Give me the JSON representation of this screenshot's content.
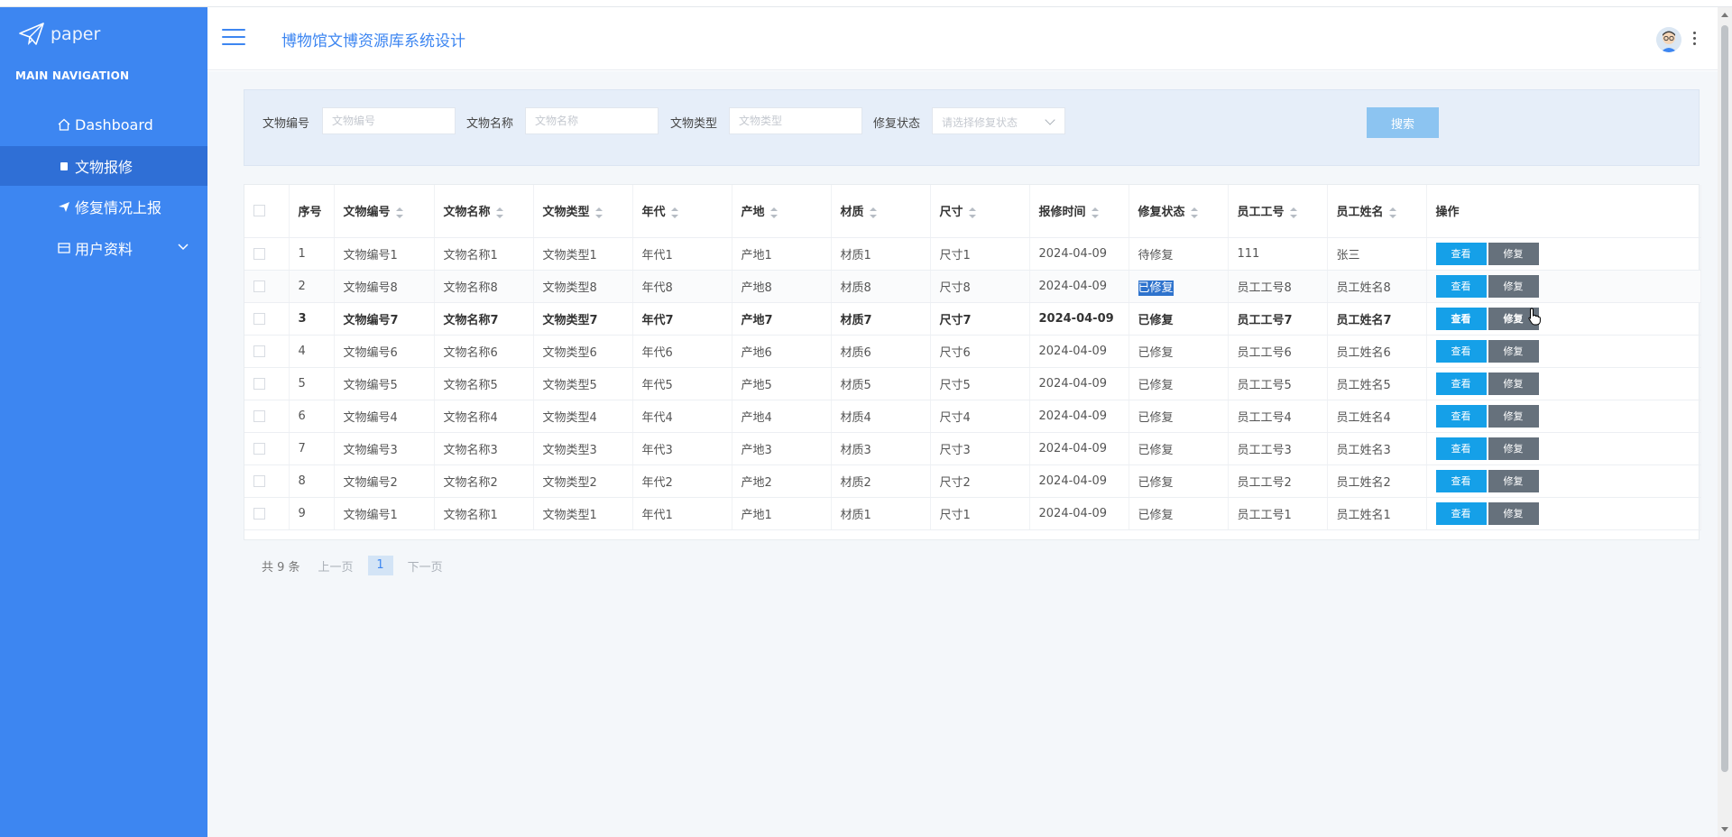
{
  "logo": {
    "text": "paper"
  },
  "nav": {
    "header": "MAIN NAVIGATION",
    "items": [
      {
        "label": "Dashboard",
        "icon": "home-icon"
      },
      {
        "label": "文物报修",
        "icon": "document-icon",
        "active": true
      },
      {
        "label": "修复情况上报",
        "icon": "paper-plane-icon"
      },
      {
        "label": "用户资料",
        "icon": "profile-card-icon",
        "expandable": true
      }
    ]
  },
  "header": {
    "title": "博物馆文博资源库系统设计"
  },
  "search": {
    "fields": [
      {
        "label": "文物编号",
        "placeholder": "文物编号"
      },
      {
        "label": "文物名称",
        "placeholder": "文物名称"
      },
      {
        "label": "文物类型",
        "placeholder": "文物类型"
      }
    ],
    "status_label": "修复状态",
    "status_placeholder": "请选择修复状态",
    "button": "搜索"
  },
  "table": {
    "columns": [
      "序号",
      "文物编号",
      "文物名称",
      "文物类型",
      "年代",
      "产地",
      "材质",
      "尺寸",
      "报修时间",
      "修复状态",
      "员工工号",
      "员工姓名",
      "操作"
    ],
    "view_label": "查看",
    "fix_label": "修复",
    "rows": [
      [
        "1",
        "文物编号1",
        "文物名称1",
        "文物类型1",
        "年代1",
        "产地1",
        "材质1",
        "尺寸1",
        "2024-04-09",
        "待修复",
        "111",
        "张三"
      ],
      [
        "2",
        "文物编号8",
        "文物名称8",
        "文物类型8",
        "年代8",
        "产地8",
        "材质8",
        "尺寸8",
        "2024-04-09",
        "已修复",
        "员工工号8",
        "员工姓名8"
      ],
      [
        "3",
        "文物编号7",
        "文物名称7",
        "文物类型7",
        "年代7",
        "产地7",
        "材质7",
        "尺寸7",
        "2024-04-09",
        "已修复",
        "员工工号7",
        "员工姓名7"
      ],
      [
        "4",
        "文物编号6",
        "文物名称6",
        "文物类型6",
        "年代6",
        "产地6",
        "材质6",
        "尺寸6",
        "2024-04-09",
        "已修复",
        "员工工号6",
        "员工姓名6"
      ],
      [
        "5",
        "文物编号5",
        "文物名称5",
        "文物类型5",
        "年代5",
        "产地5",
        "材质5",
        "尺寸5",
        "2024-04-09",
        "已修复",
        "员工工号5",
        "员工姓名5"
      ],
      [
        "6",
        "文物编号4",
        "文物名称4",
        "文物类型4",
        "年代4",
        "产地4",
        "材质4",
        "尺寸4",
        "2024-04-09",
        "已修复",
        "员工工号4",
        "员工姓名4"
      ],
      [
        "7",
        "文物编号3",
        "文物名称3",
        "文物类型3",
        "年代3",
        "产地3",
        "材质3",
        "尺寸3",
        "2024-04-09",
        "已修复",
        "员工工号3",
        "员工姓名3"
      ],
      [
        "8",
        "文物编号2",
        "文物名称2",
        "文物类型2",
        "年代2",
        "产地2",
        "材质2",
        "尺寸2",
        "2024-04-09",
        "已修复",
        "员工工号2",
        "员工姓名2"
      ],
      [
        "9",
        "文物编号1",
        "文物名称1",
        "文物类型1",
        "年代1",
        "产地1",
        "材质1",
        "尺寸1",
        "2024-04-09",
        "已修复",
        "员工工号1",
        "员工姓名1"
      ]
    ]
  },
  "pager": {
    "total": "共 9 条",
    "prev": "上一页",
    "page": "1",
    "next": "下一页"
  },
  "colors": {
    "sidebar": "#3d86f1",
    "active": "#2f6fd6",
    "view_button": "#15a0e8",
    "fix_button": "#66717c",
    "search_button": "#8cc4f1"
  }
}
